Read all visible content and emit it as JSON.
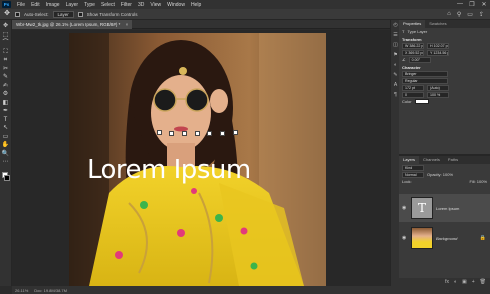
{
  "app": {
    "logo": "Ps"
  },
  "menu": [
    "File",
    "Edit",
    "Image",
    "Layer",
    "Type",
    "Select",
    "Filter",
    "3D",
    "View",
    "Window",
    "Help"
  ],
  "window_controls": [
    "—",
    "❐",
    "✕"
  ],
  "options_bar": {
    "tool_icon": "move-tool-icon",
    "auto_select_label": "Auto-Select:",
    "auto_select_value": "Layer",
    "show_transform_label": "Show Transform Controls",
    "right_icons": [
      "⌂",
      "⚲",
      "▭",
      "⇪"
    ]
  },
  "document": {
    "tab_title": "Wbr-Mw2_tk.jpg @ 26.1% (Lorem Ipsum, RGB/8#) *",
    "close": "×"
  },
  "canvas": {
    "headline": "Lorem Ipsum"
  },
  "status": {
    "zoom": "26.11%",
    "doc_info": "Doc: 19.8M/38.7M"
  },
  "panels": {
    "top_tabs": [
      "Properties",
      "Swatches"
    ],
    "layer_kind": "Type Layer",
    "transform_title": "Transform",
    "w": "W 386.22 px",
    "h": "H 102.07 px",
    "x": "X 369.52 px",
    "y": "Y 1234.56 px",
    "angle": "0.00°",
    "character_title": "Character",
    "font_family": "Bringer",
    "font_style": "Regular",
    "font_size": "172 pt",
    "leading": "(Auto)",
    "tracking": "0",
    "color_label": "Color",
    "scale": "100 %"
  },
  "layers": {
    "tabs": [
      "Layers",
      "Channels",
      "Paths"
    ],
    "kind_label": "Kind",
    "blend_mode": "Normal",
    "opacity": "Opacity: 100%",
    "lock_label": "Lock:",
    "fill": "Fill: 100%",
    "rows": [
      {
        "name": "Lorem Ipsum",
        "thumb": "T"
      },
      {
        "name": "Background",
        "thumb": ""
      }
    ],
    "footer_icons": [
      "fx",
      "◐",
      "▣",
      "+",
      "🗑"
    ]
  },
  "toolbar": {
    "tools": [
      "✥",
      "⬚",
      "⌒",
      "⛶",
      "⌗",
      "✂",
      "✎",
      "✍",
      "⚙",
      "◧",
      "✒",
      "T",
      "↖",
      "▭",
      "✋",
      "🔍",
      "⋯"
    ]
  },
  "strip_icons": [
    "◴",
    "☰",
    "◫",
    "⚑",
    "◐",
    "✎",
    "A",
    "¶"
  ],
  "colors": {
    "accent": "#31a8ff",
    "bg": "#2b2b2b",
    "panel": "#3a3a3a"
  }
}
